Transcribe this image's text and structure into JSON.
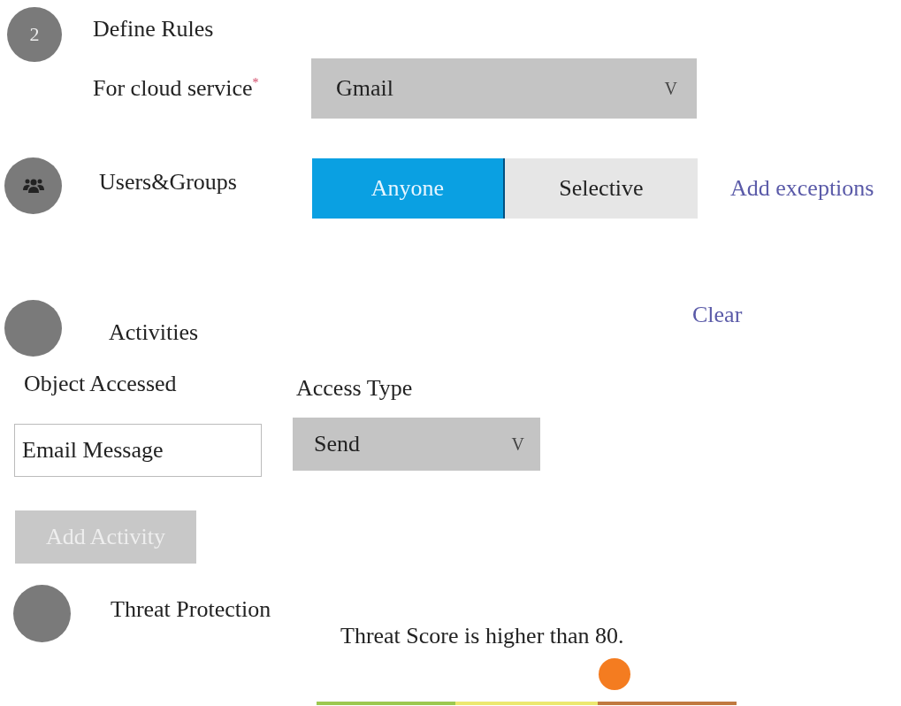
{
  "define_rules": {
    "step": "2",
    "title": "Define Rules",
    "cloud_service": {
      "label": "For cloud service",
      "required_mark": "*",
      "value": "Gmail",
      "caret": "V"
    }
  },
  "users_groups": {
    "title": "Users&Groups",
    "options": [
      {
        "label": "Anyone",
        "selected": true
      },
      {
        "label": "Selective",
        "selected": false
      }
    ],
    "link": "Add exceptions"
  },
  "activities": {
    "title": "Activities",
    "clear": "Clear",
    "object_accessed": {
      "label": "Object Accessed",
      "value": "Email Message"
    },
    "access_type": {
      "label": "Access Type",
      "value": "Send",
      "caret": "V"
    },
    "add_button": {
      "label": "Add Activity",
      "disabled": true
    }
  },
  "threat_protection": {
    "title": "Threat Protection",
    "score_text": "Threat Score is higher than 80.",
    "level": 0.705
  }
}
